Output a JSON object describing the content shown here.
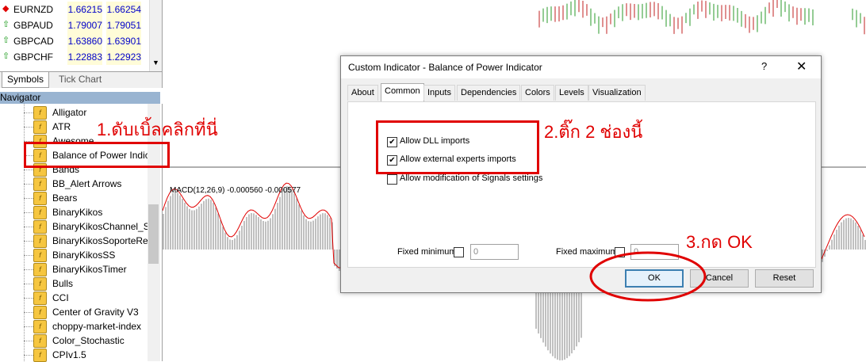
{
  "market_watch": {
    "rows": [
      {
        "symbol": "EURNZD",
        "bid": "1.66215",
        "ask": "1.66254",
        "dir": "down"
      },
      {
        "symbol": "GBPAUD",
        "bid": "1.79007",
        "ask": "1.79051",
        "dir": "up"
      },
      {
        "symbol": "GBPCAD",
        "bid": "1.63860",
        "ask": "1.63901",
        "dir": "up"
      },
      {
        "symbol": "GBPCHF",
        "bid": "1.22883",
        "ask": "1.22923",
        "dir": "up"
      }
    ],
    "tabs": [
      "Symbols",
      "Tick Chart"
    ]
  },
  "navigator": {
    "title": "Navigator",
    "items": [
      "Alligator",
      "ATR",
      "Awesome",
      "Balance of Power Indic",
      "Bands",
      "BB_Alert Arrows",
      "Bears",
      "BinaryKikos",
      "BinaryKikosChannel_Su",
      "BinaryKikosSoporteRes",
      "BinaryKikosSS",
      "BinaryKikosTimer",
      "Bulls",
      "CCI",
      "Center of Gravity V3",
      "choppy-market-index",
      "Color_Stochastic",
      "CPIv1.5"
    ]
  },
  "chart": {
    "macd_label": "MACD(12,26,9) -0.000560 -0.000577",
    "histogram_color": "#c0c0c0",
    "signal_color": "#e00000"
  },
  "dialog": {
    "title": "Custom Indicator - Balance of Power Indicator",
    "help": "?",
    "close": "✕",
    "tabs": [
      "About",
      "Common",
      "Inputs",
      "Dependencies",
      "Colors",
      "Levels",
      "Visualization"
    ],
    "active_tab": "Common",
    "checkboxes": [
      {
        "label": "Allow DLL imports",
        "checked": true
      },
      {
        "label": "Allow external experts imports",
        "checked": true
      },
      {
        "label": "Allow modification of Signals settings",
        "checked": false
      }
    ],
    "fixed_minimum": {
      "label": "Fixed minimum",
      "value": "0"
    },
    "fixed_maximum": {
      "label": "Fixed maximum",
      "value": "0"
    },
    "buttons": {
      "ok": "OK",
      "cancel": "Cancel",
      "reset": "Reset"
    }
  },
  "annotations": {
    "step1": "1.ดับเบิ้ลคลิกที่นี่",
    "step2": "2.ติ๊ก 2 ช่องนี้",
    "step3": "3.กด OK",
    "color": "#e00000"
  }
}
